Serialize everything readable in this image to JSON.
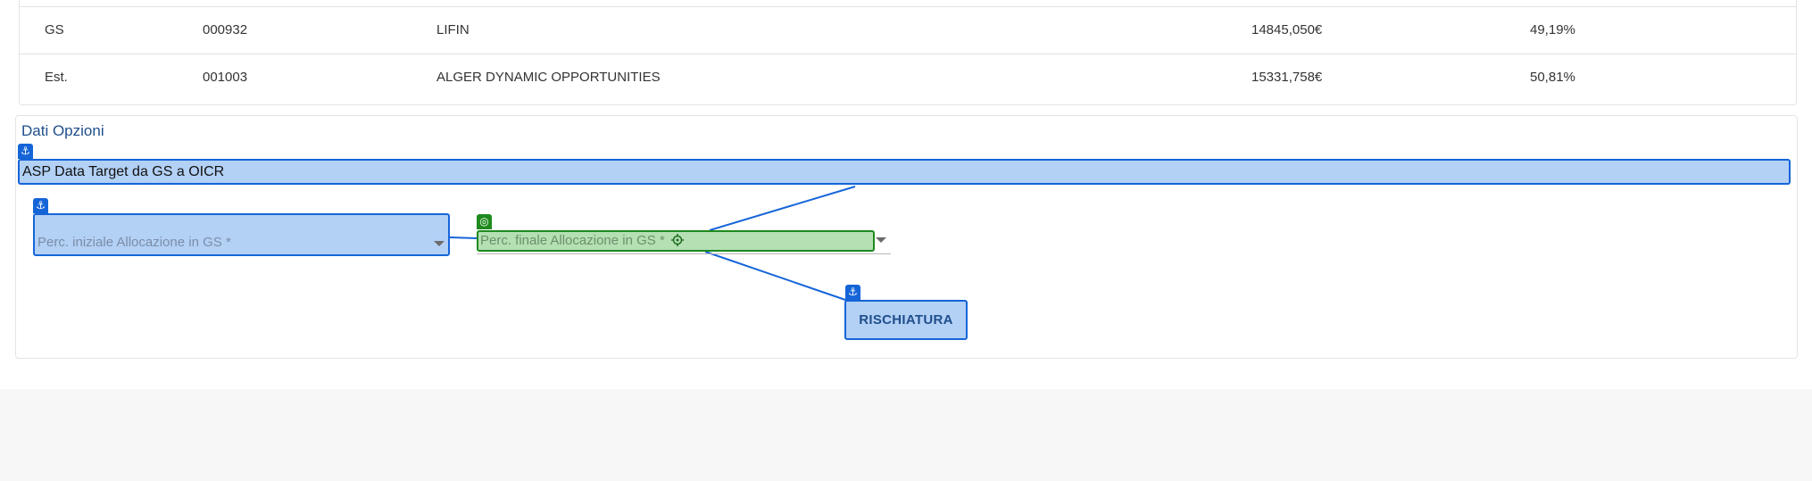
{
  "table": {
    "rows": [
      {
        "tipo": "GS",
        "codice": "000932",
        "nome": "LIFIN",
        "importo": "14845,050€",
        "percentuale": "49,19%"
      },
      {
        "tipo": "Est.",
        "codice": "001003",
        "nome": "ALGER DYNAMIC OPPORTUNITIES",
        "importo": "15331,758€",
        "percentuale": "50,81%"
      }
    ]
  },
  "options": {
    "title": "Dati Opzioni",
    "asp_label": "ASP Data Target da GS a OICR",
    "perc_iniziale_placeholder": "Perc. iniziale Allocazione in GS *",
    "perc_finale_placeholder": "Perc. finale Allocazione in GS *",
    "rischiatura_label": "RISCHIATURA"
  },
  "icons": {
    "anchor_badge": "anchor-icon",
    "target_badge": "target-icon",
    "crosshair": "crosshair-icon",
    "dropdown": "chevron-down-icon"
  },
  "colors": {
    "highlight_blue": "#b3d0f5",
    "border_blue": "#1565d8",
    "highlight_green": "#b4e0b4",
    "border_green": "#1e8a1e"
  }
}
